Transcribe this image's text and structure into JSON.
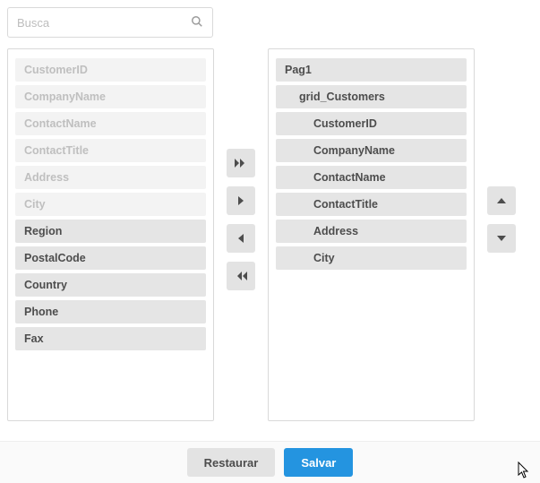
{
  "search": {
    "placeholder": "Busca"
  },
  "left": {
    "items": [
      {
        "label": "CustomerID",
        "disabled": true
      },
      {
        "label": "CompanyName",
        "disabled": true
      },
      {
        "label": "ContactName",
        "disabled": true
      },
      {
        "label": "ContactTitle",
        "disabled": true
      },
      {
        "label": "Address",
        "disabled": true
      },
      {
        "label": "City",
        "disabled": true
      },
      {
        "label": "Region",
        "disabled": false
      },
      {
        "label": "PostalCode",
        "disabled": false
      },
      {
        "label": "Country",
        "disabled": false
      },
      {
        "label": "Phone",
        "disabled": false
      },
      {
        "label": "Fax",
        "disabled": false
      }
    ]
  },
  "right": {
    "items": [
      {
        "label": "Pag1",
        "indent": 0
      },
      {
        "label": "grid_Customers",
        "indent": 1
      },
      {
        "label": "CustomerID",
        "indent": 2
      },
      {
        "label": "CompanyName",
        "indent": 2
      },
      {
        "label": "ContactName",
        "indent": 2
      },
      {
        "label": "ContactTitle",
        "indent": 2
      },
      {
        "label": "Address",
        "indent": 2
      },
      {
        "label": "City",
        "indent": 2
      }
    ]
  },
  "footer": {
    "restore": "Restaurar",
    "save": "Salvar"
  }
}
